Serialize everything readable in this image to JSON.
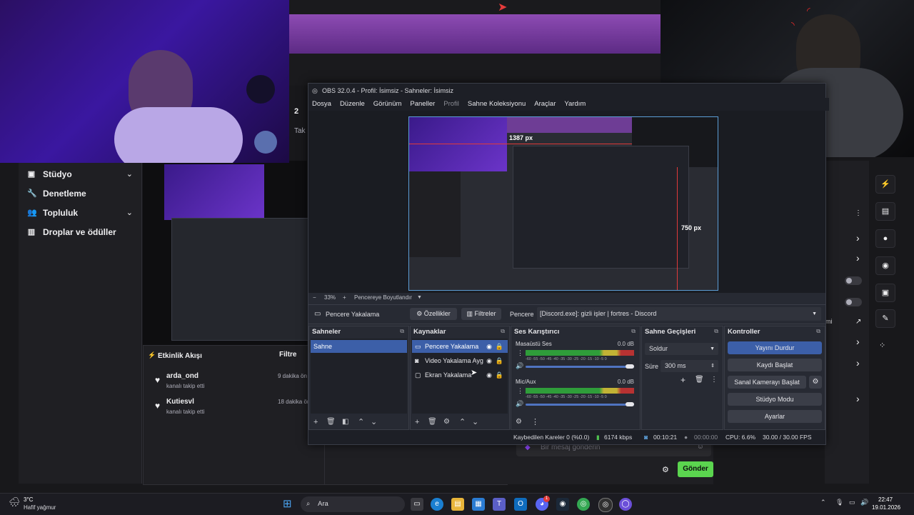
{
  "sidebar": {
    "items": [
      {
        "label": "Stüdyo",
        "has_chevron": true,
        "icon": "studio-icon"
      },
      {
        "label": "Denetleme",
        "has_chevron": false,
        "icon": "wrench-icon"
      },
      {
        "label": "Topluluk",
        "has_chevron": true,
        "icon": "community-icon"
      },
      {
        "label": "Droplar ve ödüller",
        "has_chevron": false,
        "icon": "drops-icon"
      }
    ]
  },
  "activity": {
    "title": "Etkinlik Akışı",
    "filter_label": "Filtre",
    "items": [
      {
        "name": "arda_ond",
        "action": "kanalı takip etti",
        "time": "9 dakika ön"
      },
      {
        "name": "Kutiesvl",
        "action": "kanalı takip etti",
        "time": "18 dakika ön"
      }
    ]
  },
  "chat": {
    "placeholder": "Bir mesaj gönderin",
    "send_label": "Gönder"
  },
  "obs": {
    "title": "OBS 32.0.4 - Profil: İsimsiz - Sahneler: İsimsiz",
    "menu": [
      "Dosya",
      "Düzenle",
      "Görünüm",
      "Paneller",
      "Profil",
      "Sahne Koleksiyonu",
      "Araçlar",
      "Yardım"
    ],
    "preview": {
      "width_label": "1387 px",
      "height_label": "750 px"
    },
    "zoom": {
      "value": "33%",
      "fit_label": "Pencereye Boyutlandır"
    },
    "source_bar": {
      "selected_source": "Pencere Yakalama",
      "properties_label": "Özellikler",
      "filters_label": "Filtreler",
      "window_label": "Pencere",
      "window_value": "[Discord.exe]: gizli işler | fortres - Discord"
    },
    "docks": {
      "scenes": {
        "title": "Sahneler",
        "items": [
          "Sahne"
        ]
      },
      "sources": {
        "title": "Kaynaklar",
        "items": [
          "Pencere Yakalama",
          "Video Yakalama Ayg",
          "Ekran Yakalama"
        ]
      },
      "mixer": {
        "title": "Ses Karıştırıcı",
        "channels": [
          {
            "name": "Masaüstü Ses",
            "db": "0.0 dB"
          },
          {
            "name": "Mic/Aux",
            "db": "0.0 dB"
          }
        ],
        "scale": "-60 -55 -50 -45 -40 -35 -30 -25 -20 -15 -10 -5 0"
      },
      "transitions": {
        "title": "Sahne Geçişleri",
        "type": "Soldur",
        "duration_label": "Süre",
        "duration_value": "300 ms"
      },
      "controls": {
        "title": "Kontroller",
        "buttons": [
          "Yayını Durdur",
          "Kaydı Başlat",
          "Sanal Kamerayı Başlat",
          "Stüdyo Modu",
          "Ayarlar"
        ]
      }
    },
    "status": {
      "dropped": "Kaybedilen Kareler 0 (%0.0)",
      "bitrate": "6174 kbps",
      "stream_time": "00:10:21",
      "rec_time": "00:00:00",
      "cpu": "CPU: 6.6%",
      "fps": "30.00 / 30.00 FPS"
    }
  },
  "background_texts": {
    "scene_count": "2",
    "scene_sub": "Tak",
    "side_label": "mi"
  },
  "taskbar": {
    "weather_temp": "3°C",
    "weather_desc": "Hafif yağmur",
    "search_placeholder": "Ara",
    "time": "22:47",
    "date": "19.01.2026",
    "discord_badge": "1"
  }
}
